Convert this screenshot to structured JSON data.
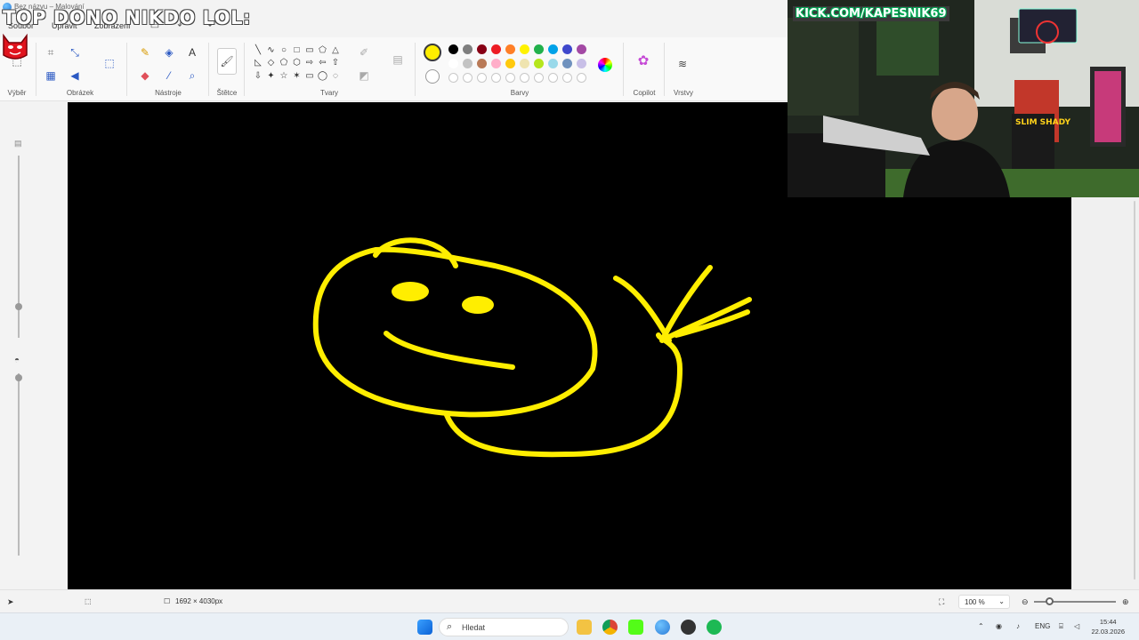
{
  "window": {
    "title": "Bez názvu – Malování"
  },
  "menu": {
    "file": "Soubor",
    "edit": "Upravit",
    "view": "Zobrazení"
  },
  "ribbon": {
    "groups": {
      "selection": "Výběr",
      "image": "Obrázek",
      "tools": "Nástroje",
      "brushes": "Štětce",
      "shapes": "Tvary",
      "colors": "Barvy",
      "copilot": "Copilot",
      "layers": "Vrstvy"
    },
    "tool_icons": [
      "pencil-icon",
      "fill-bucket-icon",
      "text-icon",
      "eraser-icon",
      "color-picker-icon",
      "magnifier-icon"
    ],
    "shape_glyphs": [
      "╲",
      "∿",
      "○",
      "□",
      "▭",
      "⬠",
      "△",
      "◺",
      "◇",
      "⬠",
      "⬡",
      "⇨",
      "⇦",
      "⇧",
      "⇩",
      "✦",
      "☆",
      "✶",
      "▭",
      "◯",
      "◌"
    ],
    "colors": {
      "primary": "#ffee00",
      "secondary": "#ffffff",
      "row1": [
        "#000000",
        "#7f7f7f",
        "#880015",
        "#ed1c24",
        "#ff7f27",
        "#fff200",
        "#22b14c",
        "#00a2e8",
        "#3f48cc",
        "#a349a4"
      ],
      "row2": [
        "#ffffff",
        "#c3c3c3",
        "#b97a57",
        "#ffaec9",
        "#ffc90e",
        "#efe4b0",
        "#b5e61d",
        "#99d9ea",
        "#7092be",
        "#c8bfe7"
      ]
    }
  },
  "canvas": {
    "background": "#000000",
    "stroke_color": "#ffee00"
  },
  "statusbar": {
    "dimensions": "1692 × 4030px",
    "zoom": "100 %"
  },
  "taskbar": {
    "search_placeholder": "Hledat",
    "language": "ENG",
    "time": "15:44",
    "date": "22.03.2026"
  },
  "stream": {
    "overlay_text": "TOP DONO NIKDO LOL:",
    "banner_text": "KICK.COM/KAPESNIK69",
    "poster_text": "SLIM SHADY"
  }
}
